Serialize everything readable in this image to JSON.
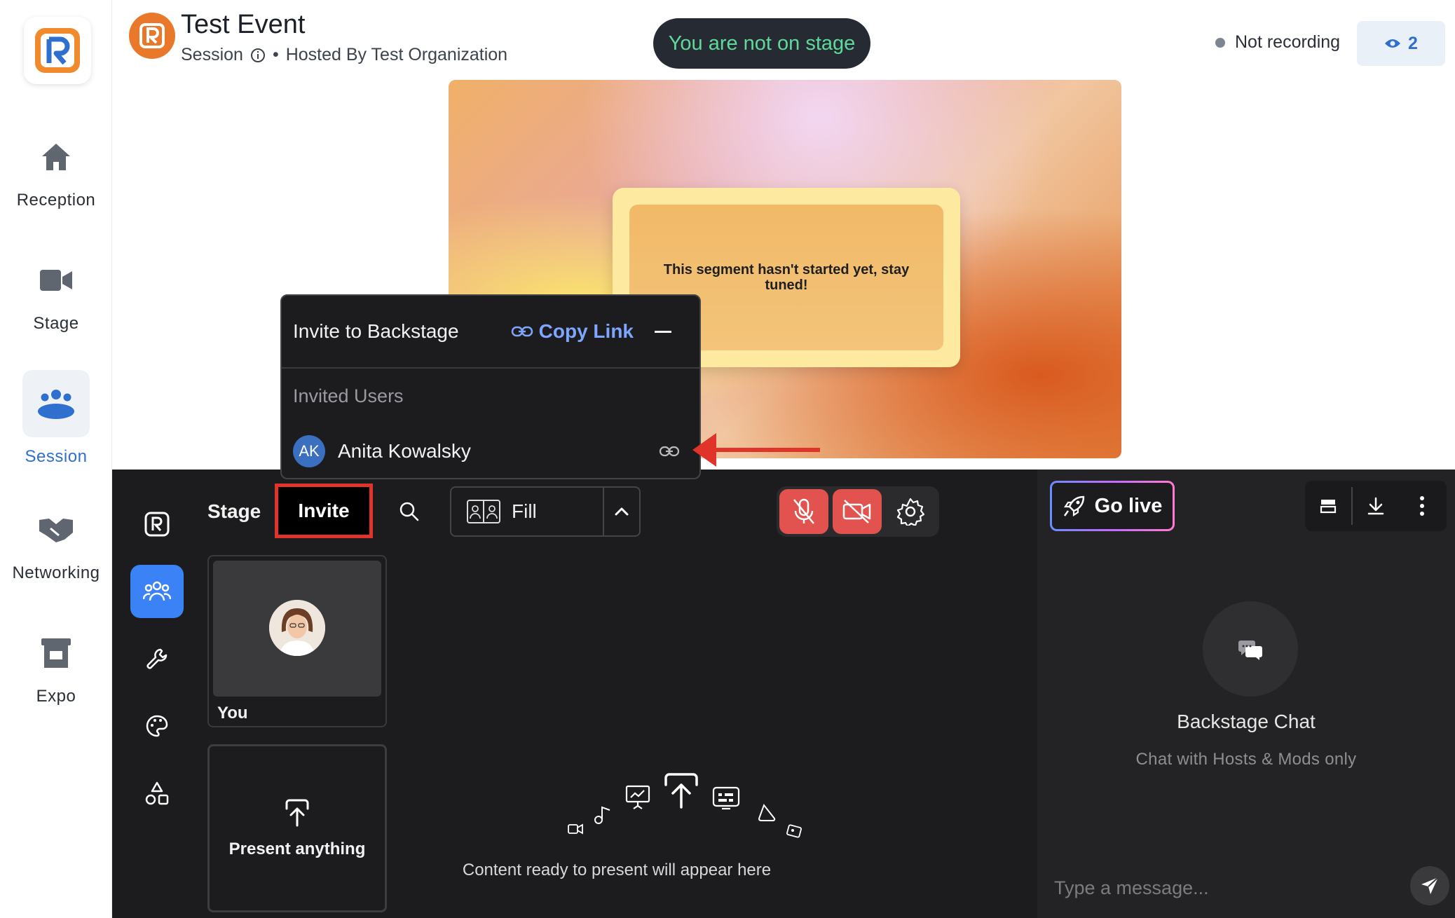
{
  "nav": {
    "items": [
      {
        "label": "Reception",
        "icon": "home-icon"
      },
      {
        "label": "Stage",
        "icon": "video-camera-icon"
      },
      {
        "label": "Session",
        "icon": "people-group-icon",
        "active": true
      },
      {
        "label": "Networking",
        "icon": "handshake-icon"
      },
      {
        "label": "Expo",
        "icon": "booth-icon"
      }
    ]
  },
  "header": {
    "title": "Test Event",
    "session_label": "Session",
    "separator": "•",
    "hosted_by": "Hosted By Test Organization",
    "stage_status": "You are not on stage",
    "recording_status": "Not recording",
    "viewer_count": "2"
  },
  "preview": {
    "message": "This segment hasn't started yet, stay tuned!"
  },
  "toolbar": {
    "stage_tab": "Stage",
    "invite_tab": "Invite",
    "layout_value": "Fill"
  },
  "tiles": {
    "you_label": "You",
    "present_label": "Present anything"
  },
  "content": {
    "empty_message": "Content ready to present will appear here"
  },
  "right_panel": {
    "go_live": "Go live",
    "chat_title": "Backstage Chat",
    "chat_subtitle": "Chat with Hosts & Mods only",
    "message_placeholder": "Type a message..."
  },
  "invite_popup": {
    "title": "Invite to Backstage",
    "copy_link": "Copy Link",
    "section_label": "Invited Users",
    "users": [
      {
        "initials": "AK",
        "name": "Anita Kowalsky"
      }
    ]
  },
  "colors": {
    "accent_blue": "#3b82f6",
    "stage_status_green": "#5fd99a",
    "annotation_red": "#e0332a",
    "mute_red": "#e2524f",
    "event_orange": "#e9782b"
  }
}
